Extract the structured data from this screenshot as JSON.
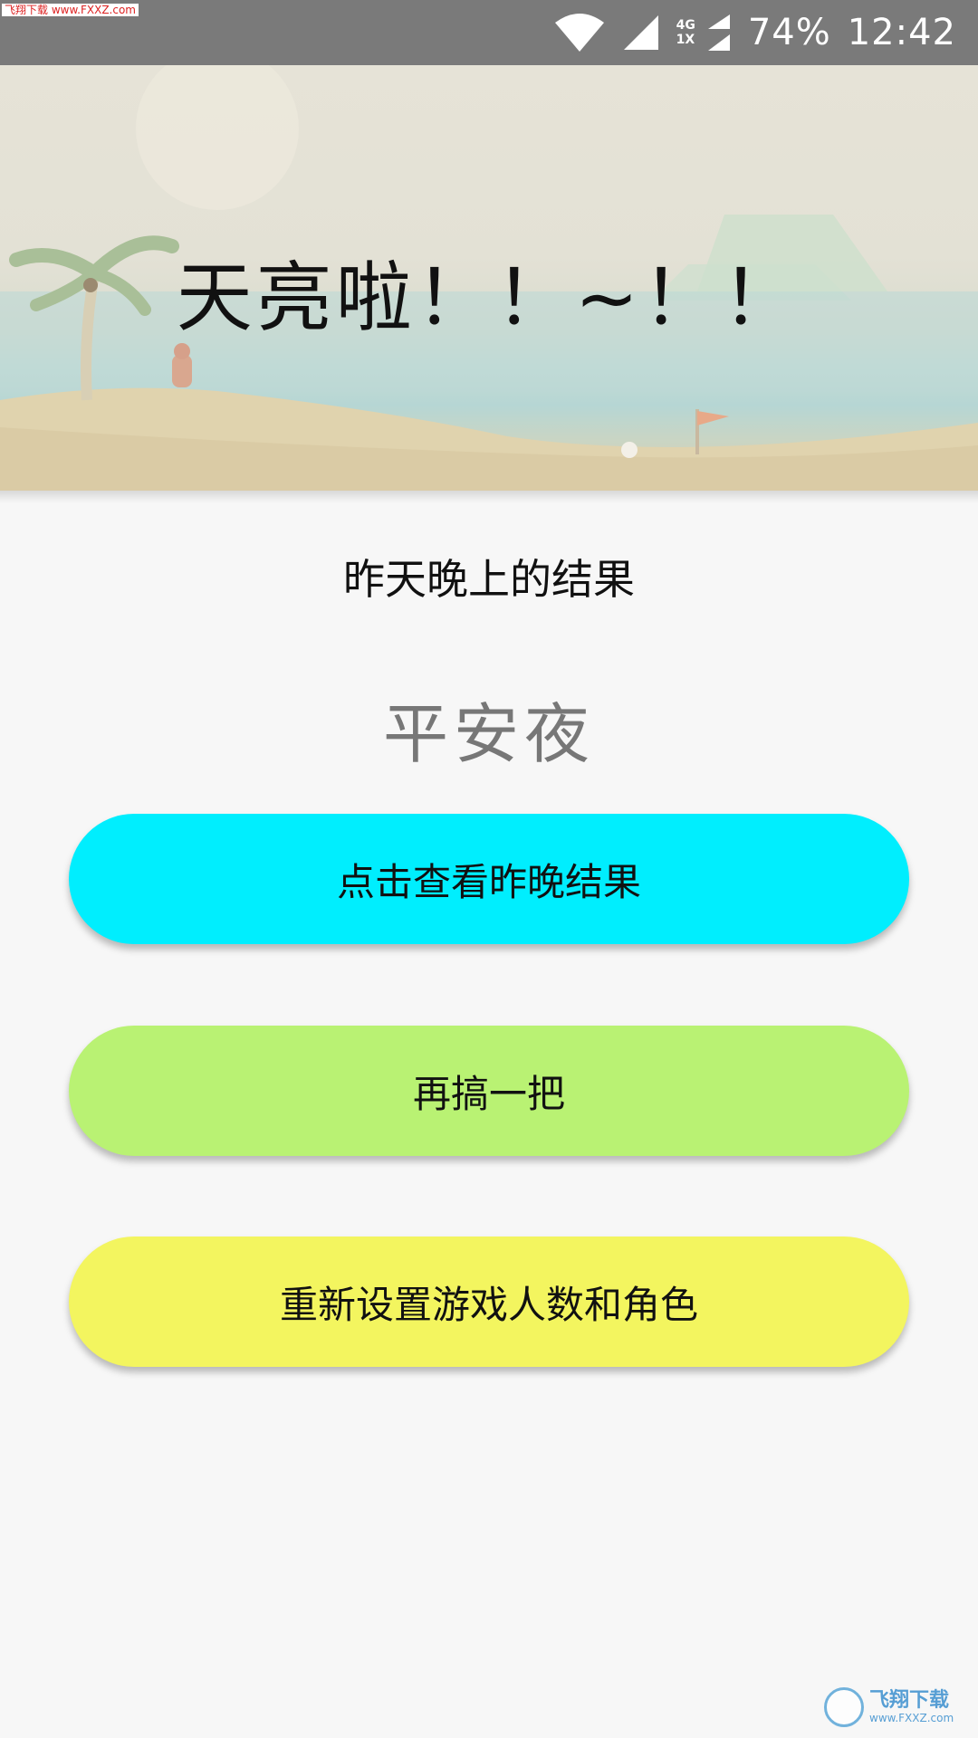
{
  "status_bar": {
    "watermark": "飞翔下载 www.FXXZ.com",
    "network_top": "4G",
    "network_bottom": "1X",
    "battery": "74%",
    "time": "12:42"
  },
  "banner": {
    "title": "天亮啦！！~！！"
  },
  "result": {
    "label": "昨天晚上的结果",
    "value": "平安夜"
  },
  "buttons": {
    "view_result": "点击查看昨晚结果",
    "play_again": "再搞一把",
    "reset": "重新设置游戏人数和角色"
  },
  "colors": {
    "view_button": "#00eefe",
    "again_button": "#b9f273",
    "reset_button": "#f3f55f"
  },
  "footer": {
    "watermark_name": "飞翔下载",
    "watermark_url": "www.FXXZ.com"
  }
}
